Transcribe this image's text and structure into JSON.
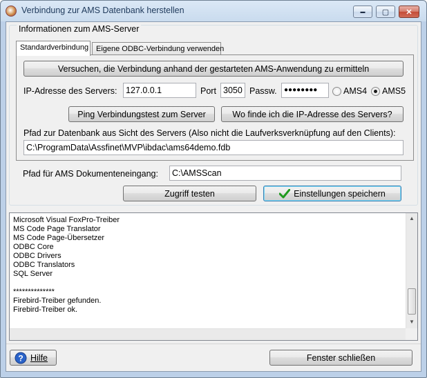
{
  "window": {
    "title": "Verbindung zur AMS Datenbank herstellen"
  },
  "caption_buttons": {
    "minimize": "▬",
    "maximize": "▢",
    "close": "✕"
  },
  "group": {
    "title": "Informationen zum AMS-Server"
  },
  "tabs": [
    {
      "label": "Standardverbindung",
      "active": true
    },
    {
      "label": "Eigene ODBC-Verbindung verwenden",
      "active": false
    }
  ],
  "standard": {
    "detect_button": "Versuchen, die Verbindung anhand der gestarteten AMS-Anwendung zu ermitteln",
    "ip_label": "IP-Adresse des Servers:",
    "ip_value": "127.0.0.1",
    "port_label": "Port",
    "port_value": "3050",
    "password_label": "Passw.",
    "password_value": "●●●●●●●●",
    "radio_ams4": "AMS4",
    "radio_ams5": "AMS5",
    "selected_version": "AMS5",
    "ping_button": "Ping Verbindungstest zum Server",
    "where_ip_button": "Wo finde ich die IP-Adresse des Servers?",
    "db_path_label": "Pfad zur Datenbank aus Sicht des Servers (Also nicht die Laufverksverknüpfung auf den Clients):",
    "db_path_value": "C:\\ProgramData\\Assfinet\\MVP\\ibdac\\ams64demo.fdb"
  },
  "doc_path": {
    "label": "Pfad für AMS Dokumenteneingang:",
    "value": "C:\\AMSScan"
  },
  "actions": {
    "test_button": "Zugriff testen",
    "save_button": "Einstellungen speichern"
  },
  "log": {
    "lines": [
      "Microsoft Visual FoxPro-Treiber",
      "MS Code Page Translator",
      "MS Code Page-Übersetzer",
      "ODBC Core",
      "ODBC Drivers",
      "ODBC Translators",
      "SQL Server",
      "",
      "**************",
      "Firebird-Treiber gefunden.",
      "Firebird-Treiber ok."
    ]
  },
  "footer": {
    "help_button": "Hilfe",
    "close_button": "Fenster schließen"
  },
  "colors": {
    "check": "#1f9a1f",
    "help_icon": "#2a63c9"
  }
}
